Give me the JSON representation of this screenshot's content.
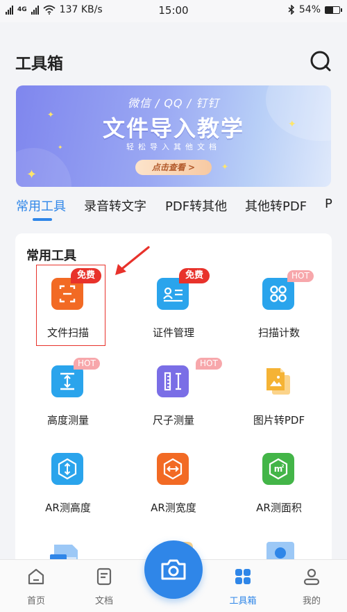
{
  "status_bar": {
    "network": "4G",
    "speed": "137 KB/s",
    "time": "15:00",
    "battery": "54%",
    "battery_level": 0.54
  },
  "header": {
    "title": "工具箱",
    "search_icon": "search-icon"
  },
  "banner": {
    "line1": "微信 / QQ / 钉钉",
    "headline": "文件导入教学",
    "line2": "轻松导入其他文档",
    "cta": "点击查看 >"
  },
  "tabs": [
    {
      "label": "常用工具",
      "active": true
    },
    {
      "label": "录音转文字",
      "active": false
    },
    {
      "label": "PDF转其他",
      "active": false
    },
    {
      "label": "其他转PDF",
      "active": false
    },
    {
      "label": "P",
      "active": false
    }
  ],
  "tools_section": {
    "heading": "常用工具",
    "items": [
      {
        "label": "文件扫描",
        "icon": "document-scan-icon",
        "badge": "免费",
        "color": "#f26a24"
      },
      {
        "label": "证件管理",
        "icon": "id-card-icon",
        "badge": "免费",
        "color": "#2aa4ec"
      },
      {
        "label": "扫描计数",
        "icon": "count-dots-icon",
        "badge": "HOT",
        "color": "#2aa4ec"
      },
      {
        "label": "高度测量",
        "icon": "height-measure-icon",
        "badge": "HOT",
        "color": "#2aa4ec"
      },
      {
        "label": "尺子测量",
        "icon": "ruler-icon",
        "badge": "HOT",
        "color": "#7a6ee6"
      },
      {
        "label": "图片转PDF",
        "icon": "image-to-pdf-icon",
        "badge": "",
        "color": "#f5b335"
      },
      {
        "label": "AR测高度",
        "icon": "ar-height-icon",
        "badge": "",
        "color": "#2aa4ec"
      },
      {
        "label": "AR测宽度",
        "icon": "ar-width-icon",
        "badge": "",
        "color": "#f26a24"
      },
      {
        "label": "AR测面积",
        "icon": "ar-area-icon",
        "badge": "",
        "color": "#43b548"
      }
    ]
  },
  "bottom_nav": [
    {
      "label": "首页",
      "icon": "home-icon",
      "active": false
    },
    {
      "label": "文档",
      "icon": "document-icon",
      "active": false
    },
    {
      "label": "工具箱",
      "icon": "toolbox-grid-icon",
      "active": true
    },
    {
      "label": "我的",
      "icon": "user-icon",
      "active": false
    }
  ],
  "camera_button": {
    "icon": "camera-icon"
  },
  "colors": {
    "accent": "#2f86e8",
    "badge_free": "#e8322b",
    "badge_hot": "#f7a7ab",
    "annotation": "#e8322b"
  }
}
